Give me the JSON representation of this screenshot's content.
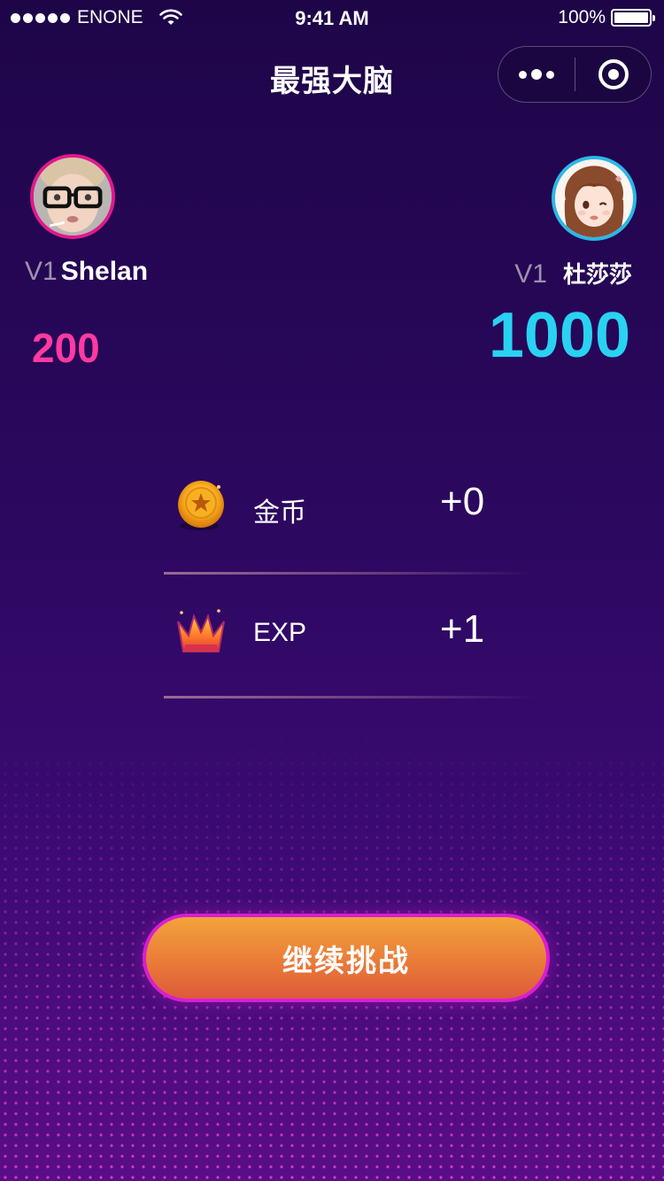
{
  "status_bar": {
    "carrier": "ENONE",
    "time": "9:41 AM",
    "battery": "100%"
  },
  "nav": {
    "title": "最强大脑",
    "icons": {
      "more": "more-dots-icon",
      "close": "target-circle-icon"
    }
  },
  "players": {
    "left": {
      "level": "V1",
      "name": "Shelan",
      "score": "200",
      "ring_color": "#e0198c",
      "score_color": "#ff3aa0"
    },
    "right": {
      "level": "V1",
      "name": "杜莎莎",
      "score": "1000",
      "ring_color": "#2bb7e8",
      "score_color": "#2ad2f2"
    }
  },
  "rewards": [
    {
      "icon": "gold-coin-icon",
      "label": "金币",
      "value": "+0"
    },
    {
      "icon": "crown-icon",
      "label": "EXP",
      "value": "+1"
    }
  ],
  "cta": {
    "label": "继续挑战"
  },
  "colors": {
    "background_top": "#1e0548",
    "background_bottom": "#5a0d86",
    "cta_orange": "#ea7b39",
    "cta_border": "#d81fd0"
  }
}
